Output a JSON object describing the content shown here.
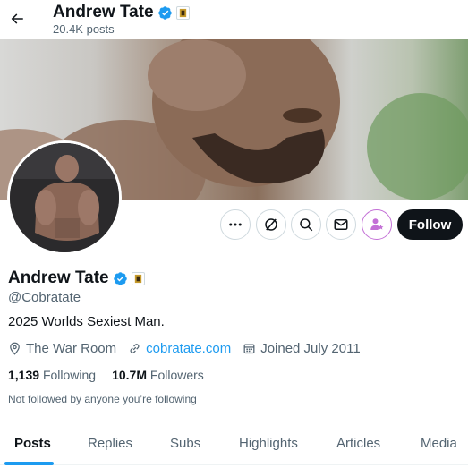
{
  "header": {
    "back_icon": "arrow-left-icon",
    "name": "Andrew Tate",
    "posts": "20.4K posts"
  },
  "profile": {
    "name": "Andrew Tate",
    "handle": "@Cobratate",
    "bio": "2025 Worlds Sexiest Man.",
    "location": "The War Room",
    "website": "cobratate.com",
    "joined": "Joined July 2011",
    "following_count": "1,139",
    "following_label": "Following",
    "followers_count": "10.7M",
    "followers_label": "Followers",
    "not_followed": "Not followed by anyone you’re following"
  },
  "actions": {
    "more_icon": "more-dots-icon",
    "grok_icon": "grok-icon",
    "search_icon": "search-icon",
    "message_icon": "envelope-icon",
    "subscribe_icon": "subscribe-person-star-icon",
    "follow_label": "Follow"
  },
  "tabs": [
    {
      "label": "Posts",
      "active": true
    },
    {
      "label": "Replies"
    },
    {
      "label": "Subs"
    },
    {
      "label": "Highlights"
    },
    {
      "label": "Articles"
    },
    {
      "label": "Media"
    }
  ],
  "colors": {
    "accent": "#1d9bf0",
    "text": "#0f1419",
    "muted": "#536471",
    "follow_bg": "#0f1419",
    "subscribe": "#c36fd6"
  }
}
